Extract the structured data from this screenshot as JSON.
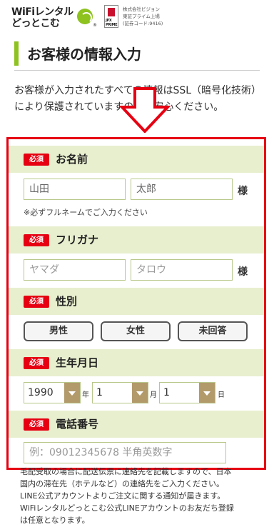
{
  "header": {
    "logo_line1": "WiFiレンタル",
    "logo_line2": "どっとこむ",
    "logo_reg": "®",
    "jpx_text": "JPX PRIME",
    "company_line1": "株式会社ビジョン",
    "company_line2": "東証プライム上場",
    "company_line3": "(証券コード:9416)"
  },
  "page": {
    "title": "お客様の情報入力",
    "intro": "お客様が入力されたすべての情報はSSL（暗号化技術）により保護されていますのでご安心ください。"
  },
  "form": {
    "required_label": "必須",
    "name": {
      "label": "お名前",
      "last_value": "山田",
      "first_value": "太郎",
      "honorific": "様",
      "note": "※必ずフルネームでご入力ください"
    },
    "kana": {
      "label": "フリガナ",
      "last_placeholder": "ヤマダ",
      "first_placeholder": "タロウ",
      "honorific": "様"
    },
    "gender": {
      "label": "性別",
      "options": [
        "男性",
        "女性",
        "未回答"
      ]
    },
    "birthday": {
      "label": "生年月日",
      "year": "1990",
      "year_unit": "年",
      "month": "1",
      "month_unit": "月",
      "day": "1",
      "day_unit": "日"
    },
    "phone": {
      "label": "電話番号",
      "placeholder": "例：09012345678 半角英数字"
    }
  },
  "footer": {
    "line1": "毛配受取の場合に配送伝票に連絡先を記載しますので、日本",
    "line2": "国内の滞在先（ホテルなど）の連絡先をご入力ください。",
    "line3": "LINE公式アカウントよりご注文に関する通知が届きます。",
    "line4": "WiFiレンタルどっとこむ公式LINEアカウントのお友だち登録",
    "line5": "は任意となります。"
  },
  "colors": {
    "brand_green": "#8dc21f",
    "highlight_red": "#e60012",
    "label_bg": "#e8efcf",
    "select_arrow": "#b29a6b"
  }
}
